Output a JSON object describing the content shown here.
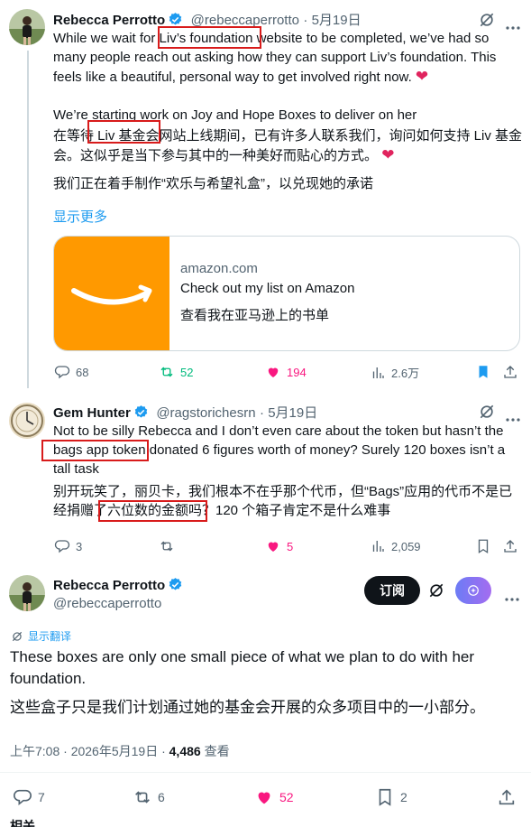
{
  "tweet1": {
    "author": "Rebecca Perrotto",
    "handle": "@rebeccaperrotto",
    "date": "5月19日",
    "line1": "While we wait for Liv’s foundation website to be completed, we’ve had so",
    "line2": "many people reach out asking how they can support Liv’s foundation. This",
    "line3": "feels like a beautiful, personal way to get involved right now.",
    "line4": "We’re starting work on Joy and Hope Boxes to deliver on her",
    "zh1": "在等待 Liv 基金会网站上线期间，已有许多人联系我们，询问如何支持 Liv 基金",
    "zh2": "会。这似乎是当下参与其中的一种美好而贴心的方式。",
    "zh3": "我们正在着手制作“欢乐与希望礼盒”，以兑现她的承诺",
    "show_more": "显示更多",
    "card": {
      "domain": "amazon.com",
      "title": "Check out my list on Amazon",
      "title_zh": "查看我在亚马逊上的书单"
    },
    "replies": "68",
    "reposts": "52",
    "likes": "194",
    "views": "2.6万"
  },
  "tweet2": {
    "author": "Gem Hunter",
    "handle": "@ragstorichesrn",
    "date": "5月19日",
    "line1": "Not to be silly Rebecca and I don’t even care about the token but hasn’t the",
    "line2": "bags app token donated 6 figures worth of money? Surely 120 boxes isn’t a",
    "line3": "tall task",
    "zh1": "别开玩笑了，丽贝卡，我们根本不在乎那个代币，但“Bags”应用的代币不是已",
    "zh2": "经捐赠了六位数的金额吗？120 个箱子肯定不是什么难事",
    "replies": "3",
    "reposts": "",
    "likes": "5",
    "views": "2,059"
  },
  "tweet3": {
    "author": "Rebecca Perrotto",
    "handle": "@rebeccaperrotto",
    "subscribe_label": "订阅",
    "show_translation": "显示翻译",
    "line1": "These boxes are only one small piece of what we plan to do with her",
    "line2": "foundation.",
    "zh1": "这些盒子只是我们计划通过她的基金会开展的众多项目中的一小部分。",
    "time": "上午7:08 · 2026年5月19日 · ",
    "views_count": "4,486",
    "views_label": " 查看",
    "replies": "7",
    "reposts": "6",
    "likes": "52",
    "bookmarks": "2"
  },
  "footer": {
    "related": "相关 ⌄"
  },
  "colors": {
    "blue": "#1d9bf0",
    "pink": "#f91880",
    "green": "#00ba7c",
    "highlight": "#d81b1b"
  }
}
